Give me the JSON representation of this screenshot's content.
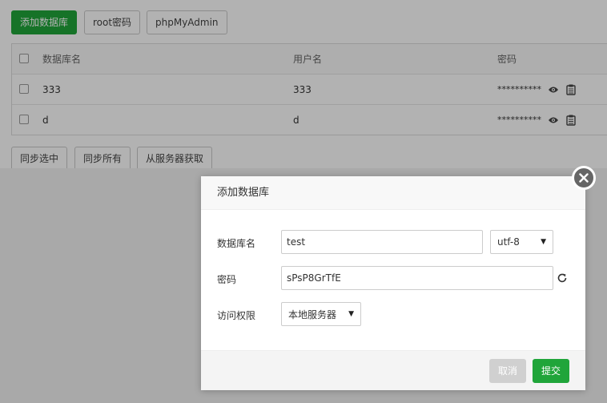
{
  "toolbar": {
    "add_db_label": "添加数据库",
    "root_pwd_label": "root密码",
    "phpmyadmin_label": "phpMyAdmin"
  },
  "table": {
    "headers": {
      "name": "数据库名",
      "user": "用户名",
      "password": "密码"
    },
    "rows": [
      {
        "name": "333",
        "user": "333",
        "password": "**********"
      },
      {
        "name": "d",
        "user": "d",
        "password": "**********"
      }
    ]
  },
  "sync": {
    "selected_label": "同步选中",
    "all_label": "同步所有",
    "fetch_label": "从服务器获取"
  },
  "dialog": {
    "title": "添加数据库",
    "db_name_label": "数据库名",
    "db_name_value": "test",
    "charset_value": "utf-8",
    "password_label": "密码",
    "password_value": "sPsP8GrTfE",
    "access_label": "访问权限",
    "access_value": "本地服务器",
    "cancel_label": "取消",
    "submit_label": "提交"
  },
  "colors": {
    "accent": "#20a53a"
  }
}
